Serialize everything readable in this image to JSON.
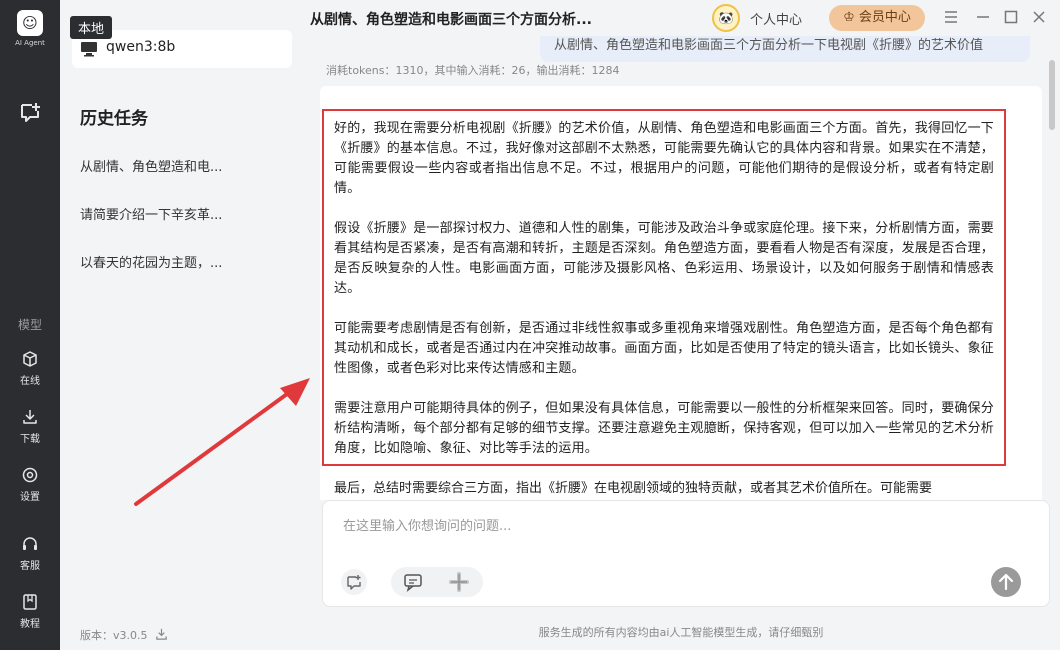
{
  "app": {
    "logo_glyph": "☺",
    "logo_text": "AI Agent"
  },
  "rail": {
    "section_label": "模型",
    "items": [
      {
        "label": "在线",
        "icon": "cube-icon"
      },
      {
        "label": "下载",
        "icon": "download-icon"
      },
      {
        "label": "设置",
        "icon": "settings-icon"
      },
      {
        "label": "客服",
        "icon": "headset-icon"
      },
      {
        "label": "教程",
        "icon": "book-icon"
      }
    ]
  },
  "sidebar": {
    "model_tag": "本地",
    "model_name": "qwen3:8b",
    "history_title": "历史任务",
    "history": [
      "从剧情、角色塑造和电...",
      "请简要介绍一下辛亥革...",
      "以春天的花园为主题，..."
    ],
    "version": "版本：v3.0.5"
  },
  "header": {
    "title": "从剧情、角色塑造和电影画面三个方面分析...",
    "personal_label": "个人中心",
    "vip_label": "会员中心"
  },
  "chat": {
    "prev_question": "从剧情、角色塑造和电影画面三个方面分析一下电视剧《折腰》的艺术价值",
    "tokens": "消耗tokens：1310，其中输入消耗：26，输出消耗：1284",
    "paragraphs": [
      "好的，我现在需要分析电视剧《折腰》的艺术价值，从剧情、角色塑造和电影画面三个方面。首先，我得回忆一下《折腰》的基本信息。不过，我好像对这部剧不太熟悉，可能需要先确认它的具体内容和背景。如果实在不清楚，可能需要假设一些内容或者指出信息不足。不过，根据用户的问题，可能他们期待的是假设分析，或者有特定剧情。",
      "假设《折腰》是一部探讨权力、道德和人性的剧集，可能涉及政治斗争或家庭伦理。接下来，分析剧情方面，需要看其结构是否紧凑，是否有高潮和转折，主题是否深刻。角色塑造方面，要看看人物是否有深度，发展是否合理，是否反映复杂的人性。电影画面方面，可能涉及摄影风格、色彩运用、场景设计，以及如何服务于剧情和情感表达。",
      "可能需要考虑剧情是否有创新，是否通过非线性叙事或多重视角来增强戏剧性。角色塑造方面，是否每个角色都有其动机和成长，或者是否通过内在冲突推动故事。画面方面，比如是否使用了特定的镜头语言，比如长镜头、象征性图像，或者色彩对比来传达情感和主题。",
      "需要注意用户可能期待具体的例子，但如果没有具体信息，可能需要以一般性的分析框架来回答。同时，要确保分析结构清晰，每个部分都有足够的细节支撑。还要注意避免主观臆断，保持客观，但可以加入一些常见的艺术分析角度，比如隐喻、象征、对比等手法的运用。"
    ],
    "after_text": "最后，总结时需要综合三方面，指出《折腰》在电视剧领域的独特贡献，或者其艺术价值所在。可能需要"
  },
  "input": {
    "placeholder": "在这里输入你想询问的问题..."
  },
  "footer": {
    "note": "服务生成的所有内容均由ai人工智能模型生成，请仔细甄别"
  },
  "colors": {
    "rail_bg": "#2b2d31",
    "highlight_border": "#e0393b",
    "vip_bg": "#f2c69a"
  }
}
